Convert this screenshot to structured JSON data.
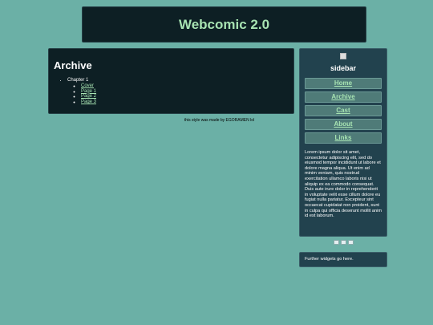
{
  "header": {
    "title": "Webcomic 2.0"
  },
  "archive": {
    "heading": "Archive",
    "chapters": [
      {
        "label": "Chapter 1",
        "pages": [
          "Cover",
          "Page 1",
          "Page 2",
          "Page 3"
        ]
      }
    ]
  },
  "credit": "this style was made by EGORAMEN lol",
  "sidebar": {
    "heading": "sidebar",
    "nav": [
      "Home",
      "Archive",
      "Cast",
      "About",
      "Links"
    ],
    "lorem": "Lorem ipsum dolor sit amet, consectetur adipiscing elit, sed do eiusmod tempor incididunt ut labore et dolore magna aliqua. Ut enim ad minim veniam, quis nostrud exercitation ullamco laboris nisi ut aliquip ex ea commodo consequat. Duis aute irure dolor in reprehenderit in voluptate velit esse cillum dolore eu fugiat nulla pariatur. Excepteur sint occaecat cupidatat non proident, sunt in culpa qui officia deserunt mollit anim id est laborum."
  },
  "widgets": {
    "text": "Further widgets go here."
  },
  "colors": {
    "background": "#6bb0a6",
    "panel": "#0d1f24",
    "sidebar": "#22424e",
    "accent": "#a7e3b2",
    "button": "#4f7b78"
  }
}
